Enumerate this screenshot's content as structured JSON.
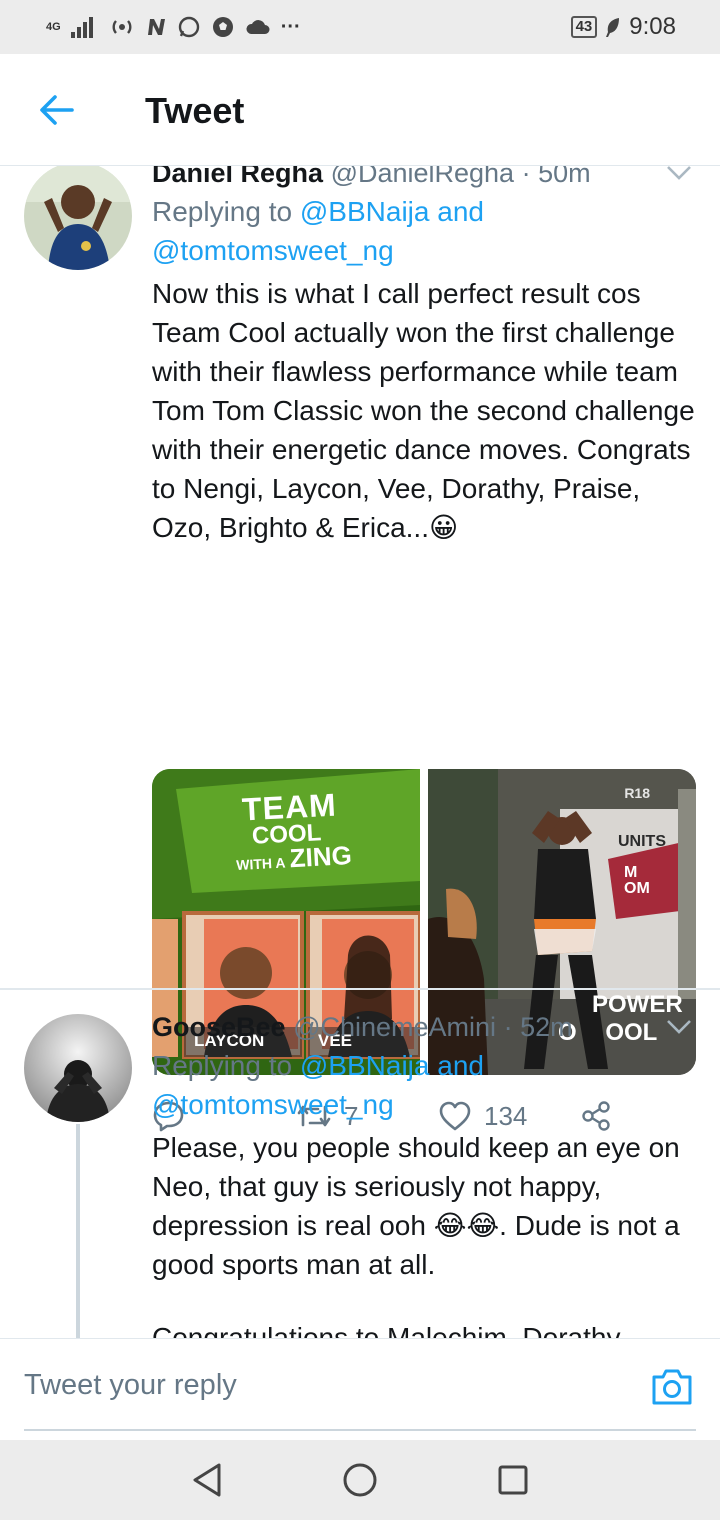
{
  "status_bar": {
    "network": "4G",
    "battery": "43",
    "time": "9:08",
    "overflow": "···"
  },
  "app_bar": {
    "title": "Tweet",
    "back_icon": "arrow-left-icon"
  },
  "tweets": [
    {
      "name": "Daniel Regha",
      "handle": "@DanielRegha",
      "time": "50m",
      "replying_prefix": "Replying to",
      "replying_to_1": "@BBNaija",
      "replying_and": "and",
      "replying_to_2": "@tomtomsweet_ng",
      "text": "Now this is what I call perfect result cos Team Cool actually won the first challenge with their flawless performance while team Tom Tom Classic won the second challenge with their  energetic dance moves. Congrats to Nengi, Laycon, Vee, Dorathy, Praise, Ozo, Brighto & Erica...😀",
      "media": {
        "left": {
          "banner_line1": "TEAM",
          "banner_line2": "COOL",
          "banner_line3_small": "WITH A",
          "banner_line3_big": "ZING",
          "card_1_label": "LAYCON",
          "card_2_label": "VEE"
        },
        "right": {
          "rating": "R18",
          "sign_top": "UNITS",
          "sign_mid1": "M",
          "sign_mid2": "OM",
          "sign_line1": "POWER",
          "sign_line2_left": "O",
          "sign_line2_right": "OOL"
        }
      },
      "stats": {
        "retweets": "7",
        "likes": "134"
      }
    },
    {
      "name": "GooseBee",
      "handle": "@ChinemeAmini",
      "time": "52m",
      "replying_prefix": "Replying to",
      "replying_to_1": "@BBNaija",
      "replying_and": "and",
      "replying_to_2": "@tomtomsweet_ng",
      "text": "Please, you people should keep an eye on Neo, that guy is seriously not happy, depression is real ooh 😂😂. Dude is not a good sports man at all.",
      "text_cutoff": "Congratulations to Malechim, Dorathy"
    }
  ],
  "composer": {
    "placeholder": "Tweet your reply"
  },
  "colors": {
    "accent": "#1da1f2",
    "muted": "#657786",
    "text": "#14171a",
    "divider": "#e1e8ed"
  }
}
